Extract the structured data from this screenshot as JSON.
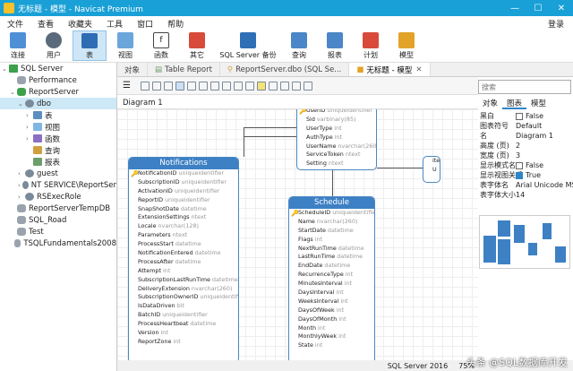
{
  "window": {
    "title": "无标题 - 模型 - Navicat Premium"
  },
  "menu": {
    "items": [
      "文件",
      "查看",
      "收藏夹",
      "工具",
      "窗口",
      "帮助"
    ],
    "login": "登录"
  },
  "toolbar": {
    "items": [
      {
        "label": "连接",
        "icon": "plug-icon",
        "color": "#4f8fd6"
      },
      {
        "label": "用户",
        "icon": "user-icon",
        "color": "#5a6a7a"
      },
      {
        "label": "表",
        "icon": "table-icon",
        "color": "#2e6db4"
      },
      {
        "label": "视图",
        "icon": "view-icon",
        "color": "#6aa6d9"
      },
      {
        "label": "函数",
        "icon": "function-icon",
        "color": "#444"
      },
      {
        "label": "其它",
        "icon": "tools-icon",
        "color": "#d84b3b"
      },
      {
        "label": "SQL Server 备份",
        "icon": "backup-icon",
        "color": "#2f6fb5"
      },
      {
        "label": "查询",
        "icon": "query-icon",
        "color": "#4b87c8"
      },
      {
        "label": "报表",
        "icon": "report-icon",
        "color": "#4b87c8"
      },
      {
        "label": "计划",
        "icon": "calendar-icon",
        "color": "#d84b3b"
      },
      {
        "label": "模型",
        "icon": "model-icon",
        "color": "#e3a329"
      }
    ]
  },
  "nav": {
    "tree": [
      {
        "label": "SQL Server",
        "icon": "server",
        "indent": 0,
        "arrow": "⌄"
      },
      {
        "label": "Performance",
        "icon": "db",
        "indent": 1,
        "arrow": ""
      },
      {
        "label": "ReportServer",
        "icon": "dbg",
        "indent": 1,
        "arrow": "⌄"
      },
      {
        "label": "dbo",
        "icon": "user",
        "indent": 2,
        "arrow": "⌄",
        "selected": true
      },
      {
        "label": "表",
        "icon": "tbl",
        "indent": 3,
        "arrow": "›"
      },
      {
        "label": "视图",
        "icon": "view",
        "indent": 3,
        "arrow": "›"
      },
      {
        "label": "函数",
        "icon": "fx",
        "indent": 3,
        "arrow": "›"
      },
      {
        "label": "查询",
        "icon": "query",
        "indent": 3,
        "arrow": ""
      },
      {
        "label": "报表",
        "icon": "report",
        "indent": 3,
        "arrow": ""
      },
      {
        "label": "guest",
        "icon": "user",
        "indent": 2,
        "arrow": "›"
      },
      {
        "label": "NT SERVICE\\ReportSer",
        "icon": "user",
        "indent": 2,
        "arrow": "›"
      },
      {
        "label": "RSExecRole",
        "icon": "user",
        "indent": 2,
        "arrow": "›"
      },
      {
        "label": "ReportServerTempDB",
        "icon": "db",
        "indent": 1,
        "arrow": ""
      },
      {
        "label": "SQL_Road",
        "icon": "db",
        "indent": 1,
        "arrow": ""
      },
      {
        "label": "Test",
        "icon": "db",
        "indent": 1,
        "arrow": ""
      },
      {
        "label": "TSQLFundamentals2008",
        "icon": "db",
        "indent": 1,
        "arrow": ""
      }
    ]
  },
  "tabs": [
    {
      "label": "对象",
      "active": false
    },
    {
      "label": "Table Report",
      "active": false
    },
    {
      "label": "ReportServer.dbo (SQL Se...",
      "active": false
    },
    {
      "label": "无标题 - 模型",
      "active": true
    }
  ],
  "diagram": {
    "tab_label": "Diagram 1"
  },
  "entities": {
    "notifications": {
      "title": "Notifications",
      "fields": [
        {
          "name": "NotificationID",
          "type": "uniqueidentifier",
          "key": true
        },
        {
          "name": "SubscriptionID",
          "type": "uniqueidentifier"
        },
        {
          "name": "ActivationID",
          "type": "uniqueidentifier"
        },
        {
          "name": "ReportID",
          "type": "uniqueidentifier"
        },
        {
          "name": "SnapShotDate",
          "type": "datetime"
        },
        {
          "name": "ExtensionSettings",
          "type": "ntext"
        },
        {
          "name": "Locale",
          "type": "nvarchar(128)"
        },
        {
          "name": "Parameters",
          "type": "ntext"
        },
        {
          "name": "ProcessStart",
          "type": "datetime"
        },
        {
          "name": "NotificationEntered",
          "type": "datetime"
        },
        {
          "name": "ProcessAfter",
          "type": "datetime"
        },
        {
          "name": "Attempt",
          "type": "int"
        },
        {
          "name": "SubscriptionLastRunTime",
          "type": "datetime"
        },
        {
          "name": "DeliveryExtension",
          "type": "nvarchar(260)"
        },
        {
          "name": "SubscriptionOwnerID",
          "type": "uniqueidentifier"
        },
        {
          "name": "IsDataDriven",
          "type": "bit"
        },
        {
          "name": "BatchID",
          "type": "uniqueidentifier"
        },
        {
          "name": "ProcessHeartbeat",
          "type": "datetime"
        },
        {
          "name": "Version",
          "type": "int"
        },
        {
          "name": "ReportZone",
          "type": "int"
        }
      ]
    },
    "users": {
      "fields": [
        {
          "name": "UserID",
          "type": "uniqueidentifier",
          "key": true
        },
        {
          "name": "Sid",
          "type": "varbinary(85)"
        },
        {
          "name": "UserType",
          "type": "int"
        },
        {
          "name": "AuthType",
          "type": "int"
        },
        {
          "name": "UserName",
          "type": "nvarchar(260)"
        },
        {
          "name": "ServiceToken",
          "type": "ntext"
        },
        {
          "name": "Setting",
          "type": "ntext"
        }
      ]
    },
    "schedule": {
      "title": "Schedule",
      "fields": [
        {
          "name": "ScheduleID",
          "type": "uniqueidentifier",
          "key": true
        },
        {
          "name": "Name",
          "type": "nvarchar(260)"
        },
        {
          "name": "StartDate",
          "type": "datetime"
        },
        {
          "name": "Flags",
          "type": "int"
        },
        {
          "name": "NextRunTime",
          "type": "datetime"
        },
        {
          "name": "LastRunTime",
          "type": "datetime"
        },
        {
          "name": "EndDate",
          "type": "datetime"
        },
        {
          "name": "RecurrenceType",
          "type": "int"
        },
        {
          "name": "MinutesInterval",
          "type": "int"
        },
        {
          "name": "DaysInterval",
          "type": "int"
        },
        {
          "name": "WeeksInterval",
          "type": "int"
        },
        {
          "name": "DaysOfWeek",
          "type": "int"
        },
        {
          "name": "DaysOfMonth",
          "type": "int"
        },
        {
          "name": "Month",
          "type": "int"
        },
        {
          "name": "MonthlyWeek",
          "type": "int"
        },
        {
          "name": "State",
          "type": "int"
        }
      ]
    },
    "partial": {
      "fields": [
        {
          "name": "ite",
          "type": ""
        },
        {
          "name": "U",
          "type": ""
        }
      ]
    }
  },
  "right": {
    "search_placeholder": "搜索",
    "tabs": [
      {
        "label": "对象",
        "active": false
      },
      {
        "label": "图表",
        "active": true
      },
      {
        "label": "模型",
        "active": false
      }
    ],
    "props": [
      {
        "k": "黑白",
        "v": "False",
        "cb": false
      },
      {
        "k": "图表符号",
        "v": "Default"
      },
      {
        "k": "名",
        "v": "Diagram 1"
      },
      {
        "k": "高度 (页)",
        "v": "2"
      },
      {
        "k": "宽度 (页)",
        "v": "3"
      },
      {
        "k": "显示模式名",
        "v": "False",
        "cb": false
      },
      {
        "k": "显示视图关系",
        "v": "True",
        "cb": true
      },
      {
        "k": "表字体名",
        "v": "Arial Unicode MS"
      },
      {
        "k": "表字体大小",
        "v": "14"
      }
    ]
  },
  "status": {
    "server": "SQL Server 2016",
    "zoom": "75%"
  },
  "watermark": "头条 @SQL数据库开发"
}
